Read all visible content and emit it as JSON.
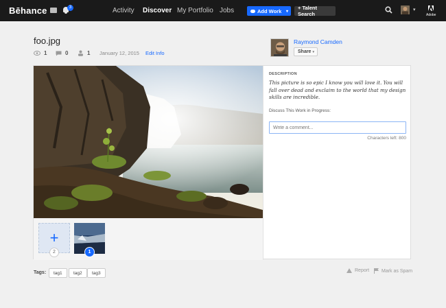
{
  "nav": {
    "logo": "Bēhance",
    "notifications_count": "3",
    "links": [
      "Activity",
      "Discover",
      "My Portfolio",
      "Jobs"
    ],
    "active_link": "Discover",
    "add_work": "Add Work",
    "talent_search": "+ Talent Search",
    "adobe": "Adobe"
  },
  "project": {
    "title": "foo.jpg",
    "views": "1",
    "comments": "0",
    "appreciations": "1",
    "date": "January 12, 2015",
    "edit_info": "Edit Info"
  },
  "owner": {
    "name": "Raymond Camden",
    "share": "Share"
  },
  "sidebar": {
    "description_label": "DESCRIPTION",
    "description": "This picture is so epic I know you will love it. You will fall over dead and exclaim to the world that my design skills are incredible.",
    "discuss_label": "Discuss This Work in Progress:",
    "comment_placeholder": "Write a comment...",
    "characters_left": "Characters left: 800"
  },
  "thumbnails": {
    "add_count": "2",
    "image_count": "1"
  },
  "footer": {
    "tags_label": "Tags:",
    "tags": [
      "tag1",
      "tag2",
      "tag3"
    ],
    "report": "Report",
    "mark_spam": "Mark as Spam"
  },
  "colors": {
    "accent": "#1769ff",
    "nav_bg": "#1a1a1a"
  }
}
